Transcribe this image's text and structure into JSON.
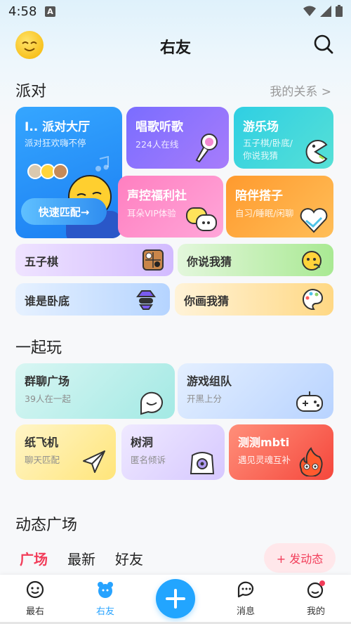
{
  "status_bar": {
    "time": "4:58",
    "app_icon": "A"
  },
  "header": {
    "title": "右友"
  },
  "party_section": {
    "title": "派对",
    "link": "我的关系 >",
    "hall": {
      "title": "I.. 派对大厅",
      "subtitle": "派对狂欢嗨不停",
      "button": "快速匹配→"
    },
    "sing": {
      "title": "唱歌听歌",
      "subtitle": "224人在线"
    },
    "amusement": {
      "title": "游乐场",
      "subtitle_1": "五子棋/卧底/",
      "subtitle_2": "你说我猜"
    },
    "voice": {
      "title": "声控福利社",
      "subtitle": "耳朵VIP体验"
    },
    "partner": {
      "title": "陪伴搭子",
      "subtitle": "自习/睡眠/闲聊"
    },
    "games": [
      "五子棋",
      "你说我猜",
      "谁是卧底",
      "你画我猜"
    ]
  },
  "play_section": {
    "title": "一起玩",
    "cards": [
      {
        "title": "群聊广场",
        "subtitle": "39人在一起"
      },
      {
        "title": "游戏组队",
        "subtitle": "开黑上分"
      },
      {
        "title": "纸飞机",
        "subtitle": "聊天匹配"
      },
      {
        "title": "树洞",
        "subtitle": "匿名倾诉"
      },
      {
        "title": "测测mbti",
        "subtitle": "遇见灵魂互补"
      }
    ]
  },
  "feed_section": {
    "title": "动态广场",
    "tabs": [
      "广场",
      "最新",
      "好友"
    ],
    "post_button": "+ 发动态"
  },
  "bottom_nav": {
    "items": [
      "最右",
      "右友",
      "",
      "消息",
      "我的"
    ],
    "active_color": "#27a3ff",
    "accent": "#f23d5a"
  }
}
